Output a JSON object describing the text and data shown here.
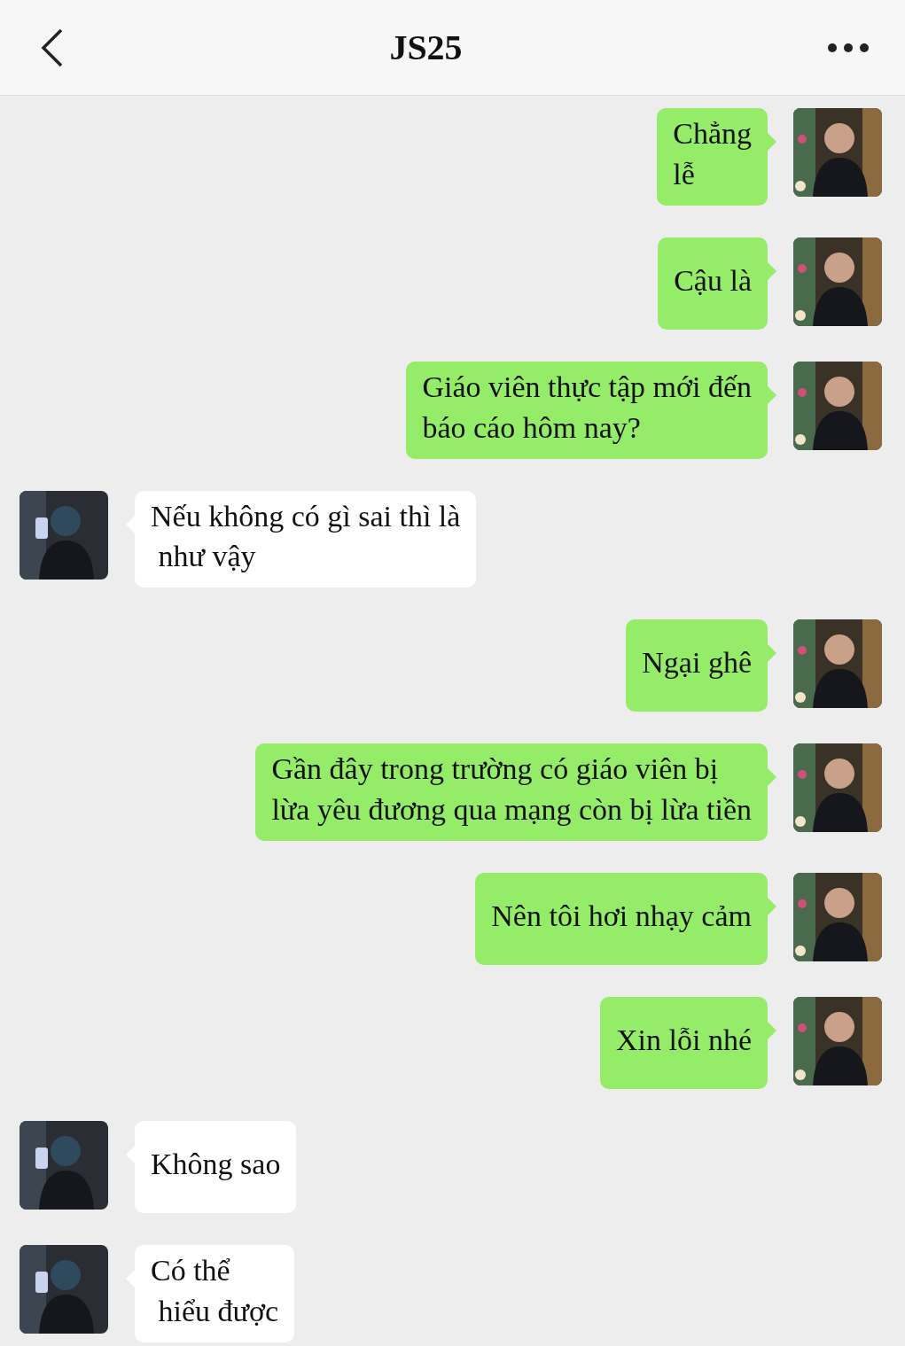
{
  "header": {
    "title": "JS25"
  },
  "messages": [
    {
      "kind": "sent",
      "text": "Chẳng\nlễ"
    },
    {
      "kind": "sent",
      "text": "Cậu là"
    },
    {
      "kind": "sent",
      "text": "Giáo viên thực tập mới đến\nbáo cáo hôm nay?"
    },
    {
      "kind": "received",
      "text": "Nếu không có gì sai thì là\n như vậy"
    },
    {
      "kind": "sent",
      "text": "Ngại ghê"
    },
    {
      "kind": "sent",
      "text": "Gần đây trong trường có giáo viên bị\nlừa yêu đương qua mạng còn bị lừa tiền"
    },
    {
      "kind": "sent",
      "text": "Nên tôi hơi nhạy cảm"
    },
    {
      "kind": "sent",
      "text": "Xin lỗi nhé"
    },
    {
      "kind": "received",
      "text": "Không sao"
    },
    {
      "kind": "received",
      "text": "Có thể\n hiểu được"
    }
  ]
}
